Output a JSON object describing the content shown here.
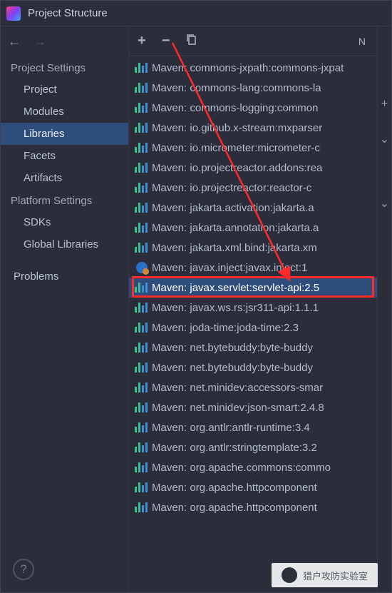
{
  "window": {
    "title": "Project Structure"
  },
  "sidebar": {
    "sections": [
      {
        "heading": "Project Settings",
        "items": [
          {
            "label": "Project",
            "selected": false
          },
          {
            "label": "Modules",
            "selected": false
          },
          {
            "label": "Libraries",
            "selected": true
          },
          {
            "label": "Facets",
            "selected": false
          },
          {
            "label": "Artifacts",
            "selected": false
          }
        ]
      },
      {
        "heading": "Platform Settings",
        "items": [
          {
            "label": "SDKs",
            "selected": false
          },
          {
            "label": "Global Libraries",
            "selected": false
          }
        ]
      }
    ],
    "bottom": {
      "label": "Problems"
    }
  },
  "toolbar": {
    "new_hint": "N"
  },
  "libraries": [
    {
      "label": "Maven: commons-jxpath:commons-jxpat",
      "icon": "lib"
    },
    {
      "label": "Maven: commons-lang:commons-la",
      "icon": "lib"
    },
    {
      "label": "Maven: commons-logging:common",
      "icon": "lib"
    },
    {
      "label": "Maven: io.github.x-stream:mxparser",
      "icon": "lib"
    },
    {
      "label": "Maven: io.micrometer:micrometer-c",
      "icon": "lib"
    },
    {
      "label": "Maven: io.projectreactor.addons:rea",
      "icon": "lib"
    },
    {
      "label": "Maven: io.projectreactor:reactor-c",
      "icon": "lib"
    },
    {
      "label": "Maven: jakarta.activation:jakarta.a",
      "icon": "lib"
    },
    {
      "label": "Maven: jakarta.annotation:jakarta.a",
      "icon": "lib"
    },
    {
      "label": "Maven: jakarta.xml.bind:jakarta.xm",
      "icon": "lib"
    },
    {
      "label": "Maven: javax.inject:javax.inject:1",
      "icon": "special"
    },
    {
      "label": "Maven: javax.servlet:servlet-api:2.5",
      "icon": "lib",
      "selected": true,
      "highlighted": true
    },
    {
      "label": "Maven: javax.ws.rs:jsr311-api:1.1.1",
      "icon": "lib"
    },
    {
      "label": "Maven: joda-time:joda-time:2.3",
      "icon": "lib"
    },
    {
      "label": "Maven: net.bytebuddy:byte-buddy",
      "icon": "lib"
    },
    {
      "label": "Maven: net.bytebuddy:byte-buddy",
      "icon": "lib"
    },
    {
      "label": "Maven: net.minidev:accessors-smar",
      "icon": "lib"
    },
    {
      "label": "Maven: net.minidev:json-smart:2.4.8",
      "icon": "lib"
    },
    {
      "label": "Maven: org.antlr:antlr-runtime:3.4",
      "icon": "lib"
    },
    {
      "label": "Maven: org.antlr:stringtemplate:3.2",
      "icon": "lib"
    },
    {
      "label": "Maven: org.apache.commons:commo",
      "icon": "lib"
    },
    {
      "label": "Maven: org.apache.httpcomponent",
      "icon": "lib"
    },
    {
      "label": "Maven: org.apache.httpcomponent",
      "icon": "lib"
    }
  ],
  "watermark": {
    "text": "猎户攻防实验室"
  }
}
